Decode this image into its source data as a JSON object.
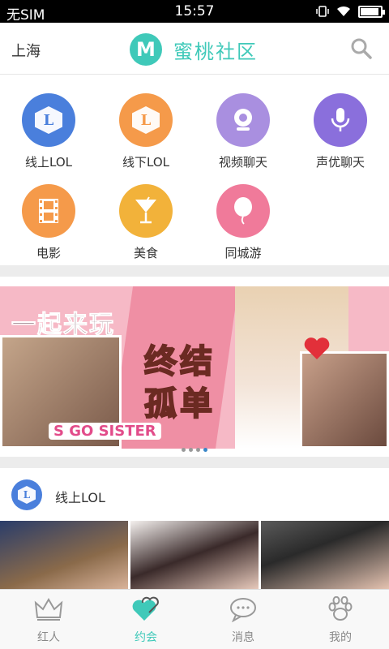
{
  "status": {
    "carrier": "无SIM",
    "time": "15:57",
    "battery_level": 0.9
  },
  "header": {
    "city": "上海",
    "logo_letter": "M",
    "title": "蜜桃社区",
    "search_icon": "search-icon"
  },
  "categories": [
    {
      "label": "线上LOL",
      "color": "#4a7fdc",
      "icon": "lol-icon"
    },
    {
      "label": "线下LOL",
      "color": "#f59a4a",
      "icon": "lol-icon"
    },
    {
      "label": "视频聊天",
      "color": "#a98fe0",
      "icon": "webcam-icon"
    },
    {
      "label": "声优聊天",
      "color": "#8a6fdc",
      "icon": "microphone-icon"
    },
    {
      "label": "电影",
      "color": "#f59a4a",
      "icon": "film-icon"
    },
    {
      "label": "美食",
      "color": "#f2b23a",
      "icon": "cocktail-icon"
    },
    {
      "label": "同城游",
      "color": "#f07a9a",
      "icon": "balloon-icon"
    }
  ],
  "banner": {
    "slogan": "一起来玩",
    "big_line1": "终结",
    "big_line2": "孤单",
    "badge": "S GO SISTER"
  },
  "carousel": {
    "count": 4,
    "active": 3
  },
  "section": {
    "title": "线上LOL",
    "icon_letter": "L"
  },
  "tabs": [
    {
      "label": "红人",
      "icon": "crown-icon",
      "active": false
    },
    {
      "label": "约会",
      "icon": "hearts-icon",
      "active": true
    },
    {
      "label": "消息",
      "icon": "chat-bubble-icon",
      "active": false
    },
    {
      "label": "我的",
      "icon": "paw-icon",
      "active": false
    }
  ]
}
